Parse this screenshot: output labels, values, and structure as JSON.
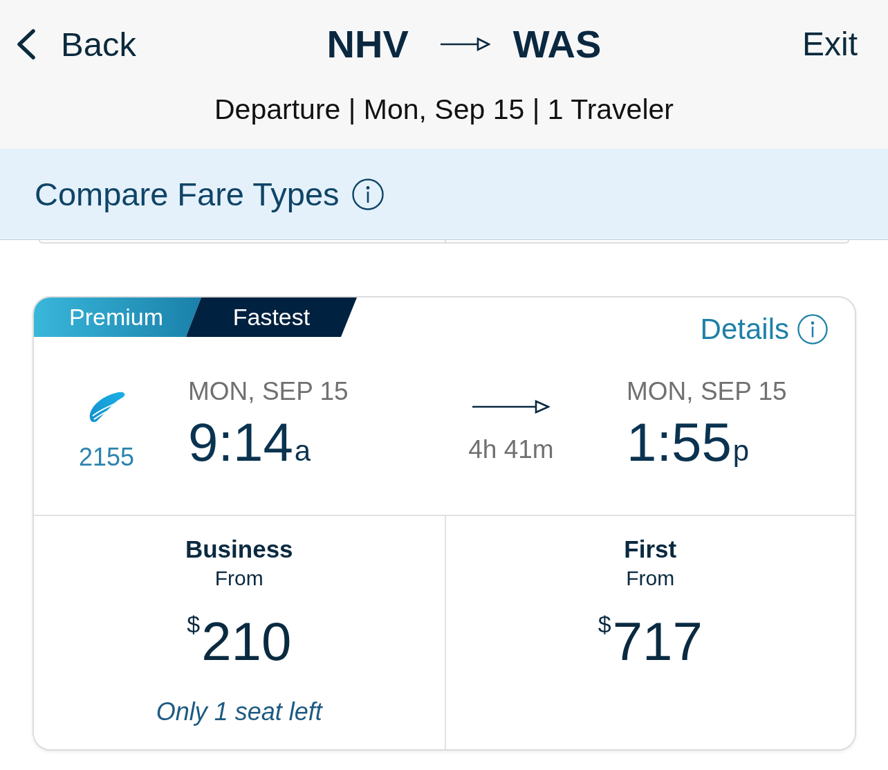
{
  "header": {
    "back": "Back",
    "origin": "NHV",
    "destination": "WAS",
    "exit": "Exit",
    "subtitle": "Departure | Mon, Sep 15 | 1 Traveler"
  },
  "compare_bar": {
    "label": "Compare Fare Types"
  },
  "train_card": {
    "tags": [
      {
        "label": "Premium",
        "kind": "premium"
      },
      {
        "label": "Fastest",
        "kind": "fastest"
      }
    ],
    "details_link": "Details",
    "train_number": "2155",
    "departure": {
      "date": "MON, SEP 15",
      "time": "9:14",
      "meridiem": "a"
    },
    "duration": "4h 41m",
    "arrival": {
      "date": "MON, SEP 15",
      "time": "1:55",
      "meridiem": "p"
    },
    "fares": [
      {
        "class": "Business",
        "from_label": "From",
        "currency": "$",
        "price": "210",
        "note": "Only 1 seat left"
      },
      {
        "class": "First",
        "from_label": "From",
        "currency": "$",
        "price": "717"
      }
    ]
  }
}
